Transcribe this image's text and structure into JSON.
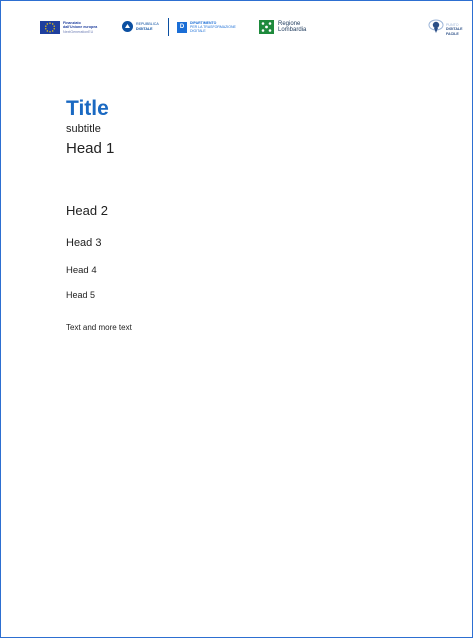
{
  "header": {
    "eu_logo": {
      "line1": "Finanziato",
      "line2": "dall'Unione europea",
      "line3": "NextGenerationEU"
    },
    "republic_logo": {
      "line1": "REPUBBLICA",
      "line2": "DIGITALE"
    },
    "department_logo": {
      "badge": "D",
      "line1": "DIPARTIMENTO",
      "line2": "PER LA TRASFORMAZIONE",
      "line3": "DIGITALE"
    },
    "region_logo": {
      "line1": "Regione",
      "line2": "Lombardia"
    },
    "project_logo": {
      "line1": "PUNTO",
      "line2": "DIGITALE",
      "line3": "FACILE"
    }
  },
  "document": {
    "title": "Title",
    "subtitle": "subtitle",
    "head1": "Head 1",
    "head2": "Head 2",
    "head3": "Head 3",
    "head4": "Head 4",
    "head5": "Head 5",
    "body_text": "Text and more text"
  },
  "colors": {
    "title_color": "#1a69c2",
    "border_color": "#2d6fd1",
    "eu_blue": "#1f3f9e",
    "lombardia_green": "#1e8a3c"
  }
}
